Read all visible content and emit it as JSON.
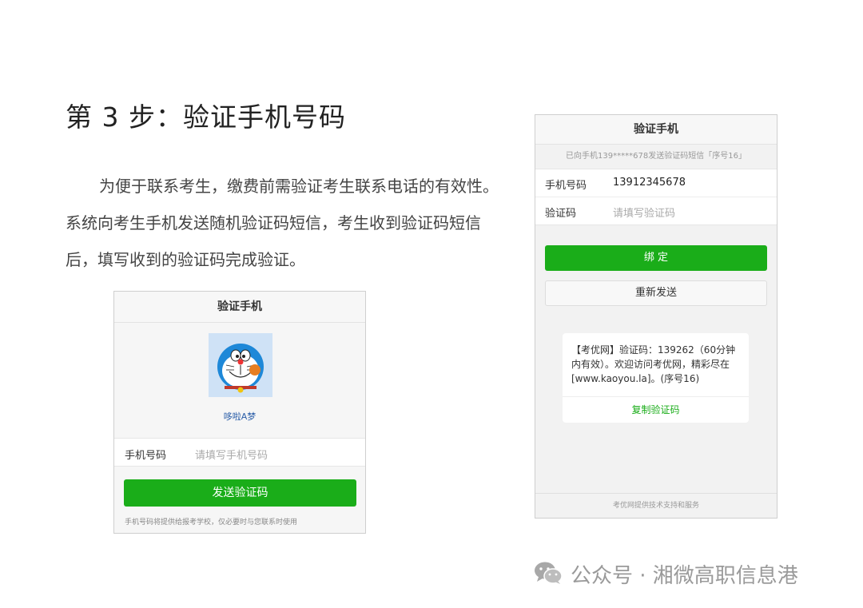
{
  "title": "第 3 步：验证手机号码",
  "paragraph": {
    "line1": "为便于联系考生，缴费前需验证考生联系电话的有效性。",
    "line2": "系统向考生手机发送随机验证码短信，考生收到验证码短信",
    "line3": "后，填写收到的验证码完成验证。"
  },
  "left_screen": {
    "header": "验证手机",
    "avatar_icon": "doraemon-avatar",
    "nickname": "哆啦A梦",
    "phone_label": "手机号码",
    "phone_placeholder": "请填写手机号码",
    "send_button": "发送验证码",
    "note": "手机号码将提供给报考学校，仅必要时与您联系时使用",
    "accent": "#1aad19"
  },
  "right_screen": {
    "header": "验证手机",
    "sent_notice": "已向手机139*****678发送验证码短信「序号16」",
    "phone_label": "手机号码",
    "phone_value": "13912345678",
    "code_label": "验证码",
    "code_placeholder": "请填写验证码",
    "bind_button": "绑 定",
    "resend_button": "重新发送",
    "sms_text": "【考优网】验证码：139262（60分钟内有效）。欢迎访问考优网，精彩尽在[www.kaoyou.la]。(序号16)",
    "copy_button": "复制验证码",
    "footer": "考优网提供技术支持和服务"
  },
  "watermark": {
    "icon": "wechat-icon",
    "text": "公众号 · 湘微高职信息港"
  }
}
